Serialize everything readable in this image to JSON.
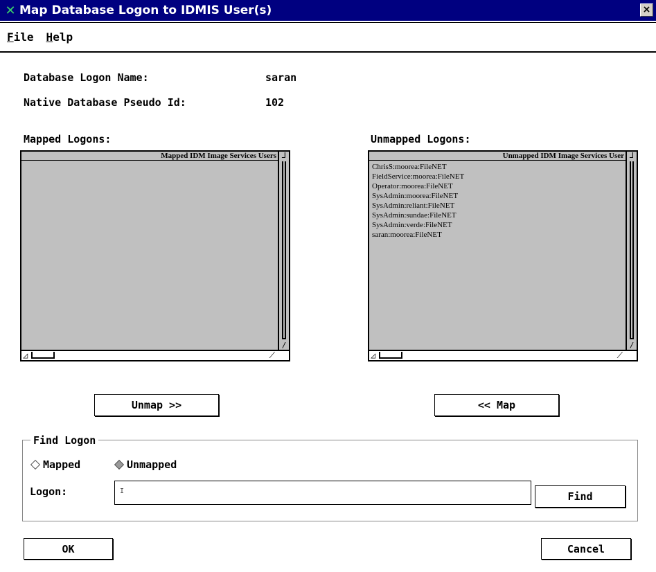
{
  "window": {
    "title": "Map Database Logon to IDMIS User(s)",
    "close_glyph": "×"
  },
  "menu": [
    {
      "mnemonic": "F",
      "rest": "ile"
    },
    {
      "mnemonic": "H",
      "rest": "elp"
    }
  ],
  "info": {
    "logon_name_label": "Database Logon Name:",
    "logon_name_value": "saran",
    "pseudo_id_label": "Native Database Pseudo Id:",
    "pseudo_id_value": "102"
  },
  "mapped": {
    "label": "Mapped Logons:",
    "header": "Mapped IDM Image Services Users",
    "items": []
  },
  "unmapped": {
    "label": "Unmapped Logons:",
    "header": "Unmapped IDM Image Services User",
    "items": [
      "ChrisS:moorea:FileNET",
      "FieldService:moorea:FileNET",
      "Operator:moorea:FileNET",
      "SysAdmin:moorea:FileNET",
      "SysAdmin:reliant:FileNET",
      "SysAdmin:sundae:FileNET",
      "SysAdmin:verde:FileNET",
      "saran:moorea:FileNET"
    ]
  },
  "buttons": {
    "unmap": "Unmap >>",
    "map": "<< Map",
    "find": "Find",
    "ok": "OK",
    "cancel": "Cancel"
  },
  "find_group": {
    "legend": "Find Logon",
    "radio_mapped": "Mapped",
    "radio_unmapped": "Unmapped",
    "selected": "Unmapped",
    "logon_label": "Logon:",
    "logon_value": ""
  },
  "colors": {
    "titlebar": "#000080",
    "list_bg": "#c0c0c0"
  }
}
